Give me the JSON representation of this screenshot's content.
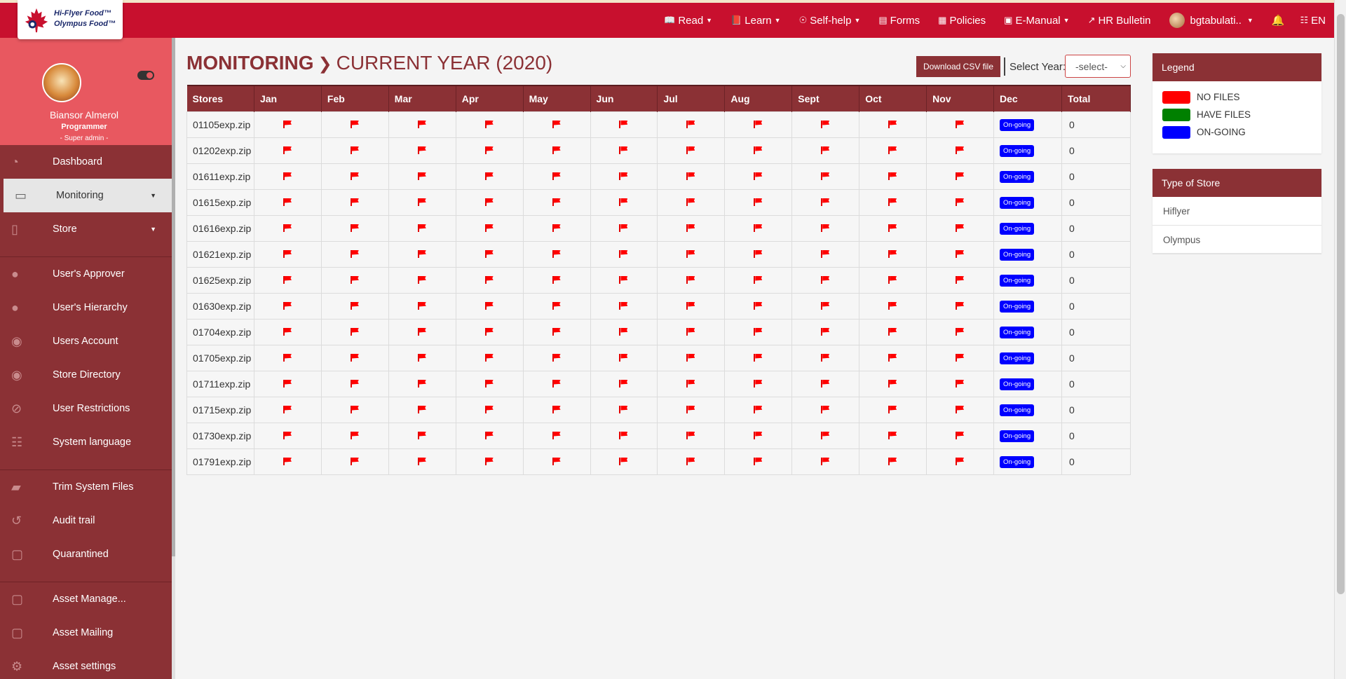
{
  "brand": {
    "logo_line1": "Hi-Flyer Food™",
    "logo_line2": "Olympus Food™"
  },
  "nav": {
    "items": [
      {
        "icon": "book-open-icon",
        "label": "Read",
        "caret": true
      },
      {
        "icon": "book-icon",
        "label": "Learn",
        "caret": true
      },
      {
        "icon": "lifebuoy-icon",
        "label": "Self-help",
        "caret": true
      },
      {
        "icon": "form-icon",
        "label": "Forms",
        "caret": false
      },
      {
        "icon": "list-icon",
        "label": "Policies",
        "caret": false
      },
      {
        "icon": "manual-icon",
        "label": "E-Manual",
        "caret": true
      },
      {
        "icon": "pin-icon",
        "label": "HR Bulletin",
        "caret": false
      }
    ],
    "user": "bgtabulati..",
    "language": "EN"
  },
  "profile": {
    "name": "Biansor Almerol",
    "role": "Programmer",
    "sub": "- Super admin -"
  },
  "sidebar": {
    "groups": [
      [
        {
          "icon": "dashboard-icon",
          "label": "Dashboard",
          "active": false,
          "caret": false
        },
        {
          "icon": "monitor-icon",
          "label": "Monitoring",
          "active": true,
          "caret": true
        },
        {
          "icon": "file-icon",
          "label": "Store",
          "active": false,
          "caret": true
        }
      ],
      [
        {
          "icon": "user-icon",
          "label": "User's Approver"
        },
        {
          "icon": "user-icon",
          "label": "User's Hierarchy"
        },
        {
          "icon": "user-circle-icon",
          "label": "Users Account"
        },
        {
          "icon": "user-circle-icon",
          "label": "Store Directory"
        },
        {
          "icon": "ban-icon",
          "label": "User Restrictions"
        },
        {
          "icon": "language-icon",
          "label": "System language"
        }
      ],
      [
        {
          "icon": "eraser-icon",
          "label": "Trim System Files"
        },
        {
          "icon": "history-icon",
          "label": "Audit trail"
        },
        {
          "icon": "inbox-icon",
          "label": "Quarantined"
        }
      ],
      [
        {
          "icon": "inbox-icon",
          "label": "Asset Manage..."
        },
        {
          "icon": "inbox-icon",
          "label": "Asset Mailing"
        },
        {
          "icon": "gear-icon",
          "label": "Asset settings"
        }
      ]
    ]
  },
  "page": {
    "title_bold": "MONITORING",
    "title_rest": "CURRENT YEAR (2020)",
    "download_label": "Download CSV file",
    "year_label": "Select Year:",
    "year_value": "-select-"
  },
  "table": {
    "headers": [
      "Stores",
      "Jan",
      "Feb",
      "Mar",
      "Apr",
      "May",
      "Jun",
      "Jul",
      "Aug",
      "Sept",
      "Oct",
      "Nov",
      "Dec",
      "Total"
    ],
    "months_status": "no-files",
    "dec_badge": "On-going",
    "rows": [
      {
        "store": "01105exp.zip",
        "total": "0"
      },
      {
        "store": "01202exp.zip",
        "total": "0"
      },
      {
        "store": "01611exp.zip",
        "total": "0"
      },
      {
        "store": "01615exp.zip",
        "total": "0"
      },
      {
        "store": "01616exp.zip",
        "total": "0"
      },
      {
        "store": "01621exp.zip",
        "total": "0"
      },
      {
        "store": "01625exp.zip",
        "total": "0"
      },
      {
        "store": "01630exp.zip",
        "total": "0"
      },
      {
        "store": "01704exp.zip",
        "total": "0"
      },
      {
        "store": "01705exp.zip",
        "total": "0"
      },
      {
        "store": "01711exp.zip",
        "total": "0"
      },
      {
        "store": "01715exp.zip",
        "total": "0"
      },
      {
        "store": "01730exp.zip",
        "total": "0"
      },
      {
        "store": "01791exp.zip",
        "total": "0"
      }
    ]
  },
  "legend": {
    "title": "Legend",
    "items": [
      {
        "label": "NO FILES",
        "color": "#ff0000"
      },
      {
        "label": "HAVE FILES",
        "color": "#008000"
      },
      {
        "label": "ON-GOING",
        "color": "#0000ff"
      }
    ]
  },
  "store_types": {
    "title": "Type of Store",
    "items": [
      "Hiflyer",
      "Olympus"
    ]
  },
  "colors": {
    "header_red": "#c8102e",
    "sidebar_maroon": "#8b3135",
    "profile_pink": "#e85860",
    "flag_red": "#ff0000",
    "ongoing_blue": "#0000ff"
  }
}
